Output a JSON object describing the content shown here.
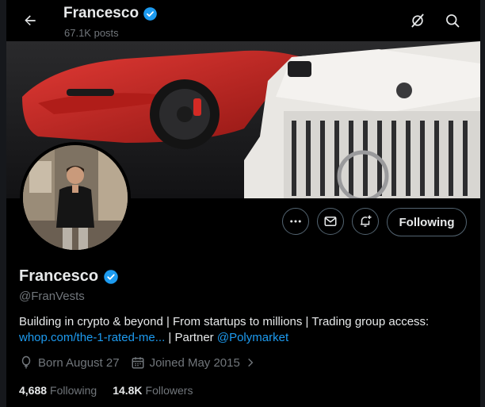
{
  "header": {
    "name": "Francesco",
    "posts": "67.1K posts"
  },
  "profile": {
    "display_name": "Francesco",
    "handle": "@FranVests",
    "verified_color": "#1d9bf0",
    "bio_text": "Building in crypto & beyond | From startups to millions | Trading group access:",
    "bio_link": "whop.com/the-1-rated-me...",
    "bio_partner_text": "| Partner",
    "bio_mention": "@Polymarket",
    "born": "Born August 27",
    "joined": "Joined May 2015",
    "following_count": "4,688",
    "following_label": "Following",
    "followers_count": "14.8K",
    "followers_label": "Followers"
  },
  "actions": {
    "following_button": "Following"
  },
  "icons": {
    "back": "arrow-left-icon",
    "grok": "grok-icon",
    "search": "search-icon",
    "more": "more-icon",
    "message": "mail-icon",
    "notify": "bell-plus-icon",
    "birthday": "balloon-icon",
    "calendar": "calendar-icon"
  },
  "colors": {
    "accent": "#1d9bf0",
    "background": "#000000",
    "muted": "#71767b",
    "border": "#536471"
  }
}
